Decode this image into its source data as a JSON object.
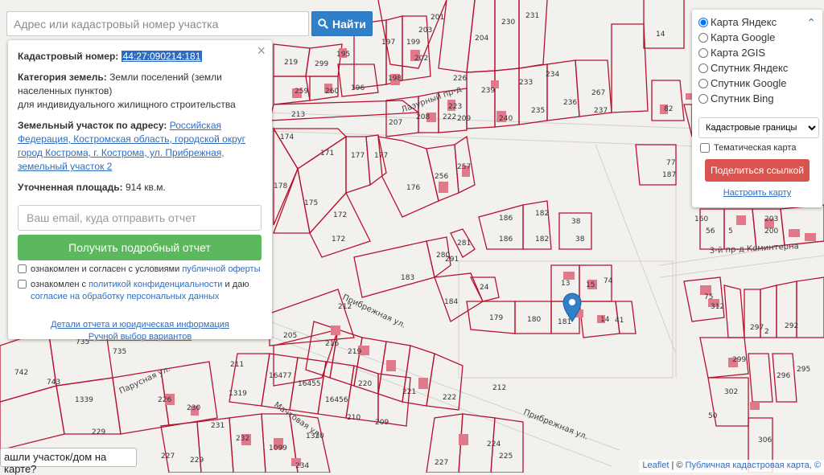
{
  "search": {
    "placeholder": "Адрес или кадастровый номер участка",
    "button_label": "Найти"
  },
  "info": {
    "cad_label": "Кадастровый номер:",
    "cad_number": "44:27:090214:181",
    "category_label": "Категория земель:",
    "category_value": "Земли поселений (земли населенных пунктов)",
    "usage": "для индивидуального жилищного строительства",
    "address_label": "Земельный участок по адресу:",
    "address_value": "Российская Федерация, Костромская область, городской округ город Кострома, г. Кострома, ул. Прибрежная, земельный участок 2",
    "area_label": "Уточненная площадь:",
    "area_value": "914 кв.м.",
    "email_placeholder": "Ваш email, куда отправить отчет",
    "report_button": "Получить подробный отчет",
    "agree1_text": "ознакомлен и согласен с условиями ",
    "agree1_link": "публичной оферты",
    "agree2_text": "ознакомлен с ",
    "agree2_link": "политикой конфиденциальности",
    "agree2_mid": " и даю ",
    "agree2_link2": "согласие на обработку персональных данных",
    "details_link": "Детали отчета и юридическая информация",
    "manual_link": "Ручной выбор вариантов",
    "close": "×"
  },
  "layers": {
    "options": [
      {
        "label": "Карта Яндекс",
        "checked": true
      },
      {
        "label": "Карта Google",
        "checked": false
      },
      {
        "label": "Карта 2GIS",
        "checked": false
      },
      {
        "label": "Спутник Яндекс",
        "checked": false
      },
      {
        "label": "Спутник Google",
        "checked": false
      },
      {
        "label": "Спутник Bing",
        "checked": false
      }
    ],
    "select_value": "Кадастровые границы",
    "thematic": "Тематическая карта",
    "share": "Поделиться ссылкой",
    "config": "Настроить карту",
    "collapse_icon": "chevron-up-icon"
  },
  "bottom_question": "ашли участок/дом на карте?",
  "attribution": {
    "leaflet": "Leaflet",
    "sep": " | © ",
    "source": "Публичная кадастровая карта, ©"
  },
  "map": {
    "streets": [
      "Лазурный пр-д",
      "Прибрежная ул.",
      "Прибрежная ул.",
      "Парусная ул.",
      "Мачтовая ул.",
      "3-й пр-д Коминтерна"
    ],
    "plots": [
      "201",
      "230",
      "231",
      "204",
      "14",
      "197",
      "199",
      "202",
      "203",
      "195",
      "219",
      "299",
      "213",
      "259",
      "260",
      "196",
      "198",
      "226",
      "233",
      "234",
      "267",
      "223",
      "239",
      "240",
      "235",
      "236",
      "237",
      "213",
      "207",
      "208",
      "222",
      "209",
      "82",
      "174",
      "171",
      "177",
      "177",
      "256",
      "257",
      "176",
      "187",
      "77",
      "178",
      "175",
      "172",
      "172",
      "186",
      "186",
      "182",
      "182",
      "38",
      "38",
      "281",
      "280",
      "291",
      "183",
      "184",
      "24",
      "13",
      "15",
      "74",
      "179",
      "180",
      "181",
      "14",
      "41",
      "212",
      "205",
      "216",
      "219",
      "211",
      "16477",
      "16455",
      "16456",
      "220",
      "221",
      "210",
      "209",
      "222",
      "212",
      "742",
      "743",
      "735",
      "1339",
      "226",
      "230",
      "1319",
      "231",
      "232",
      "229",
      "227",
      "229",
      "1320",
      "1099",
      "234",
      "224",
      "225",
      "227",
      "160",
      "203",
      "200",
      "5",
      "56",
      "312",
      "75",
      "297",
      "2",
      "292",
      "299",
      "296",
      "295",
      "302",
      "306",
      "50"
    ]
  },
  "colors": {
    "parcel": "#b5122f",
    "building": "#e07a8a",
    "search_button": "#2f7fc9",
    "report_button": "#5cb85c",
    "share_button": "#d9534f",
    "marker": "#2f7fc9"
  }
}
